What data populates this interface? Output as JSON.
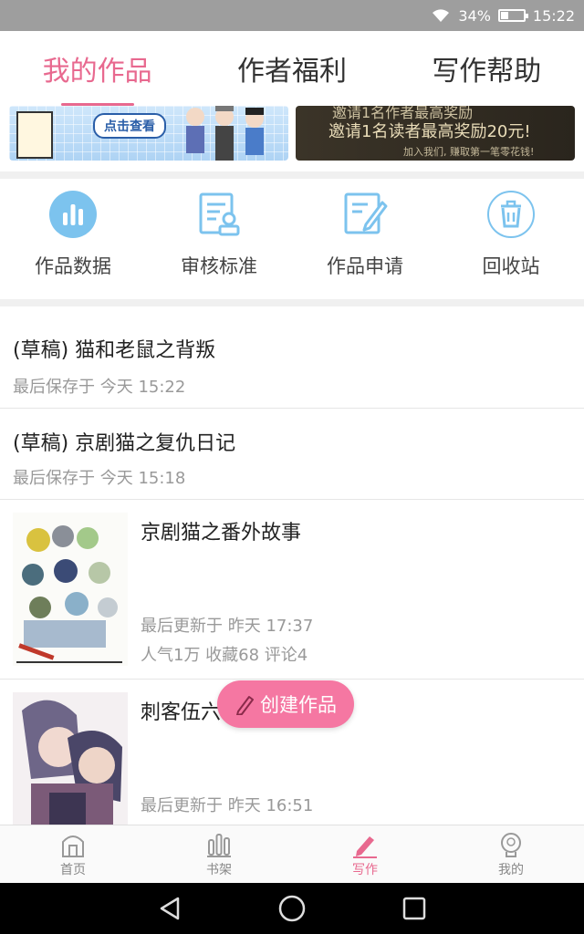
{
  "status_bar": {
    "wifi_icon": "wifi-icon",
    "battery_percent": "34%",
    "time": "15:22"
  },
  "tabs": [
    {
      "label": "我的作品",
      "active": true
    },
    {
      "label": "作者福利",
      "active": false
    },
    {
      "label": "写作帮助",
      "active": false
    }
  ],
  "banners": {
    "left": {
      "button_label": "点击查看"
    },
    "right": {
      "line1": "邀请1名读者最高奖励20元!",
      "line2": "加入我们, 赚取第一笔零花钱!",
      "partial_top": "邀请1名作者最高奖励"
    }
  },
  "menu": [
    {
      "label": "作品数据",
      "icon": "bar-chart-icon"
    },
    {
      "label": "审核标准",
      "icon": "review-doc-icon"
    },
    {
      "label": "作品申请",
      "icon": "edit-doc-icon"
    },
    {
      "label": "回收站",
      "icon": "trash-icon"
    }
  ],
  "drafts": [
    {
      "title": "(草稿) 猫和老鼠之背叛",
      "saved": "最后保存于 今天 15:22"
    },
    {
      "title": "(草稿) 京剧猫之复仇日记",
      "saved": "最后保存于 今天 15:18"
    }
  ],
  "works": [
    {
      "title": "京剧猫之番外故事",
      "updated": "最后更新于 昨天 17:37",
      "stats": "人气1万 收藏68 评论4"
    },
    {
      "title": "刺客伍六",
      "updated": "最后更新于 昨天 16:51",
      "stats": ""
    }
  ],
  "fab": {
    "label": "创建作品",
    "icon": "pencil-icon"
  },
  "bottom_nav": [
    {
      "label": "首页",
      "icon": "home-icon",
      "active": false
    },
    {
      "label": "书架",
      "icon": "bookshelf-icon",
      "active": false
    },
    {
      "label": "写作",
      "icon": "pen-icon",
      "active": true
    },
    {
      "label": "我的",
      "icon": "profile-icon",
      "active": false
    }
  ],
  "colors": {
    "accent": "#e8698f",
    "fab": "#f577a2",
    "icon_blue": "#7cc3ee"
  }
}
